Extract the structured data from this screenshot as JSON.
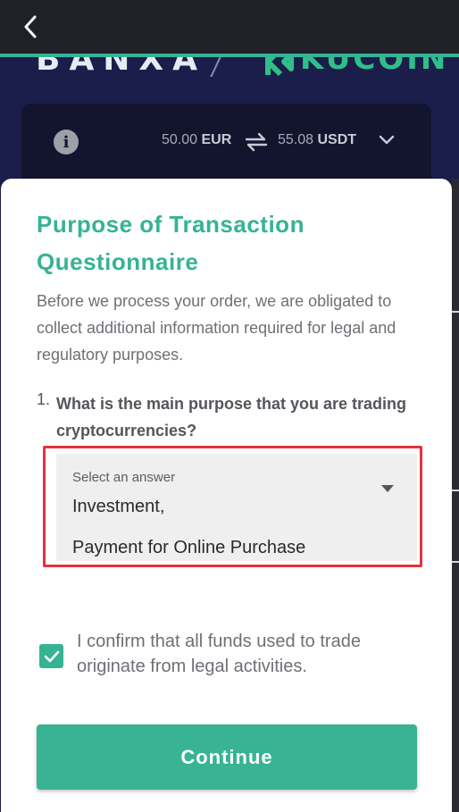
{
  "header": {
    "back_icon": "chevron-left-icon",
    "brand_left": "BANXA",
    "brand_right": "KUCOIN"
  },
  "quote": {
    "info_icon": "info-icon",
    "info_symbol": "i",
    "from_amount": "50.00",
    "from_currency": "EUR",
    "to_amount": "55.08",
    "to_currency": "USDT",
    "swap_icon": "swap-arrows-icon",
    "expand_icon": "chevron-down-icon"
  },
  "modal": {
    "title": "Purpose of Transaction Questionnaire",
    "intro": "Before we process your order, we are obligated to collect additional information required for legal and regulatory purposes.",
    "question": {
      "number": "1.",
      "text": "What is the main purpose that you are trading cryptocurrencies?",
      "select_label": "Select an answer",
      "selected_value": "Investment,\nPayment for Online Purchase",
      "caret_icon": "caret-down-icon"
    },
    "confirm": {
      "checked": true,
      "text": "I confirm that all funds used to trade originate from legal activities."
    },
    "continue_label": "Continue"
  },
  "colors": {
    "accent": "#36b393",
    "highlight_border": "#e0343d",
    "background": "#1b1d4a"
  }
}
